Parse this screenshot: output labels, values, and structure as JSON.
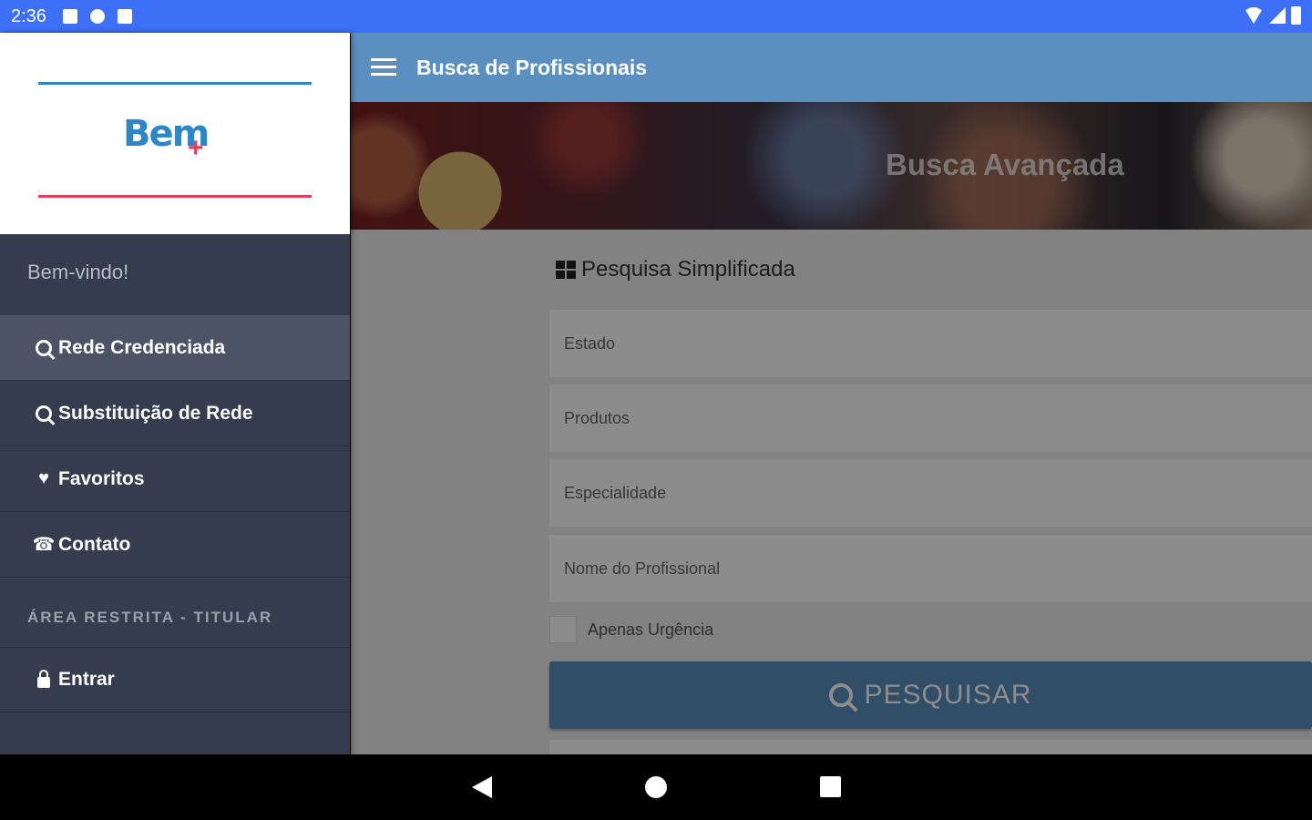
{
  "status_bar": {
    "time": "2:36"
  },
  "app_bar": {
    "title": "Busca de Profissionais"
  },
  "banner": {
    "title": "Busca Avançada"
  },
  "drawer": {
    "logo_text": "Bem",
    "logo_plus": "+",
    "welcome": "Bem-vindo!",
    "items": [
      {
        "label": "Rede Credenciada",
        "icon": "search-icon",
        "active": true
      },
      {
        "label": "Substituição de Rede",
        "icon": "search-icon",
        "active": false
      },
      {
        "label": "Favoritos",
        "icon": "heart-icon",
        "active": false
      },
      {
        "label": "Contato",
        "icon": "phone-icon",
        "active": false
      }
    ],
    "section_label": "ÁREA RESTRITA - TITULAR",
    "login_item": {
      "label": "Entrar",
      "icon": "lock-icon"
    }
  },
  "form": {
    "section_title": "Pesquisa Simplificada",
    "fields": [
      {
        "placeholder": "Estado"
      },
      {
        "placeholder": "Produtos"
      },
      {
        "placeholder": "Especialidade"
      },
      {
        "placeholder": "Nome do Profissional"
      }
    ],
    "checkbox_label": "Apenas Urgência",
    "search_button": "PESQUISAR"
  },
  "colors": {
    "status_bar": "#3d6ff7",
    "app_bar": "#5a8fc0",
    "drawer": "#343c4e",
    "logo_blue": "#2f86c4",
    "logo_red": "#e53c5a"
  }
}
